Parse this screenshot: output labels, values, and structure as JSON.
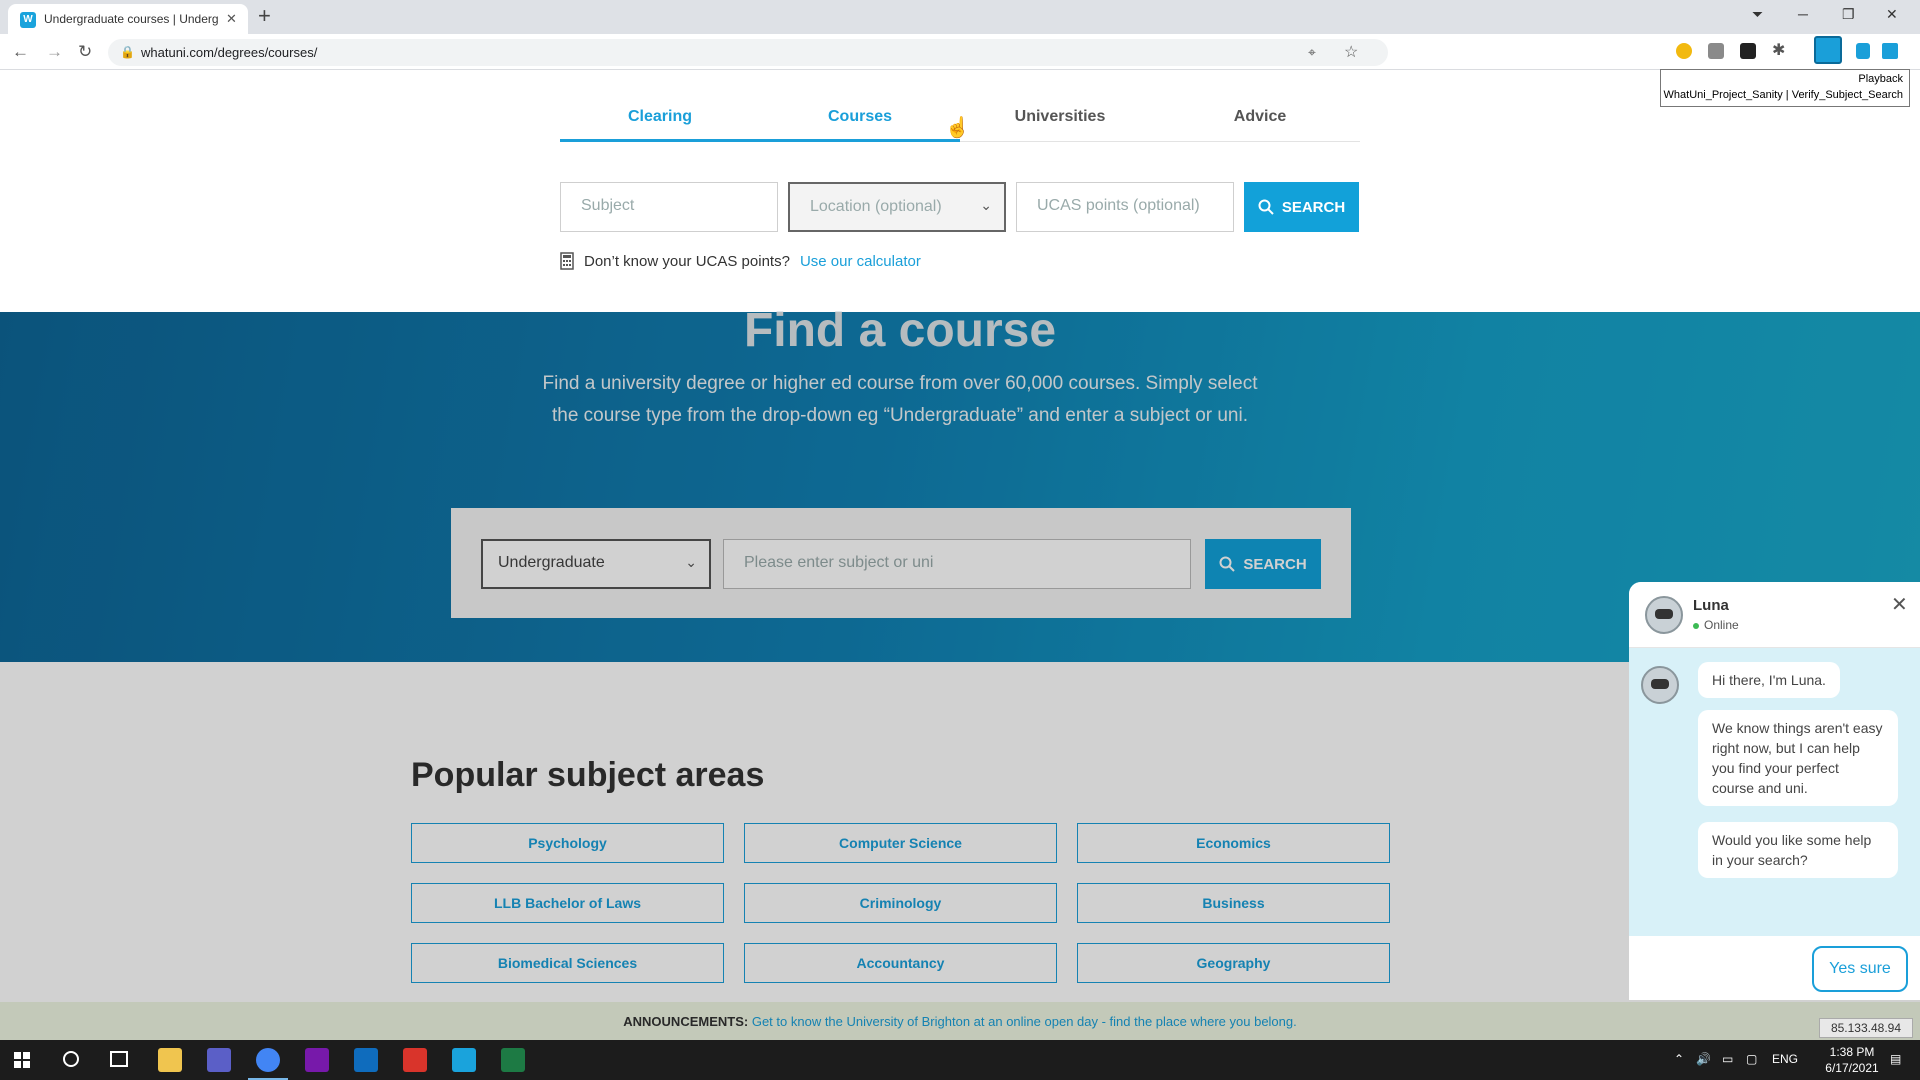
{
  "browser": {
    "tab_title": "Undergraduate courses | Underg",
    "tab_favicon": "W",
    "url": "whatuni.com/degrees/courses/",
    "tooltip_line1": "Playback",
    "tooltip_line2": "WhatUni_Project_Sanity | Verify_Subject_Search"
  },
  "nav": {
    "tabs": [
      "Clearing",
      "Courses",
      "Universities",
      "Advice"
    ],
    "active_color": "#1a9fd9"
  },
  "search": {
    "subject_placeholder": "Subject",
    "location_placeholder": "Location (optional)",
    "ucas_placeholder": "UCAS points (optional)",
    "button_label": "SEARCH",
    "calc_text": "Don’t know your UCAS points?",
    "calc_link": "Use our calculator"
  },
  "hero": {
    "title": "Find a course",
    "description": "Find a university degree or higher ed course from over 60,000 courses. Simply select the course type from the drop-down eg “Undergraduate” and enter a subject or uni.",
    "course_type": "Undergraduate",
    "input_placeholder": "Please enter subject or uni",
    "button_label": "SEARCH"
  },
  "popular": {
    "title": "Popular subject areas",
    "subjects": [
      "Psychology",
      "Computer Science",
      "Economics",
      "LLB Bachelor of Laws",
      "Criminology",
      "Business",
      "Biomedical Sciences",
      "Accountancy",
      "Geography"
    ]
  },
  "announcement": {
    "label": "ANNOUNCEMENTS:",
    "text": "Get to know the University of Brighton at an online open day - find the place where you belong."
  },
  "chat": {
    "name": "Luna",
    "status": "Online",
    "messages": [
      "Hi there, I'm Luna.",
      "We know things aren't easy right now, but I can help you find your perfect course and uni.",
      "Would you like some help in your search?"
    ],
    "reply_button": "Yes sure"
  },
  "ip_badge": "85.133.48.94",
  "taskbar": {
    "time": "1:38 PM",
    "date": "6/17/2021",
    "language": "ENG"
  }
}
